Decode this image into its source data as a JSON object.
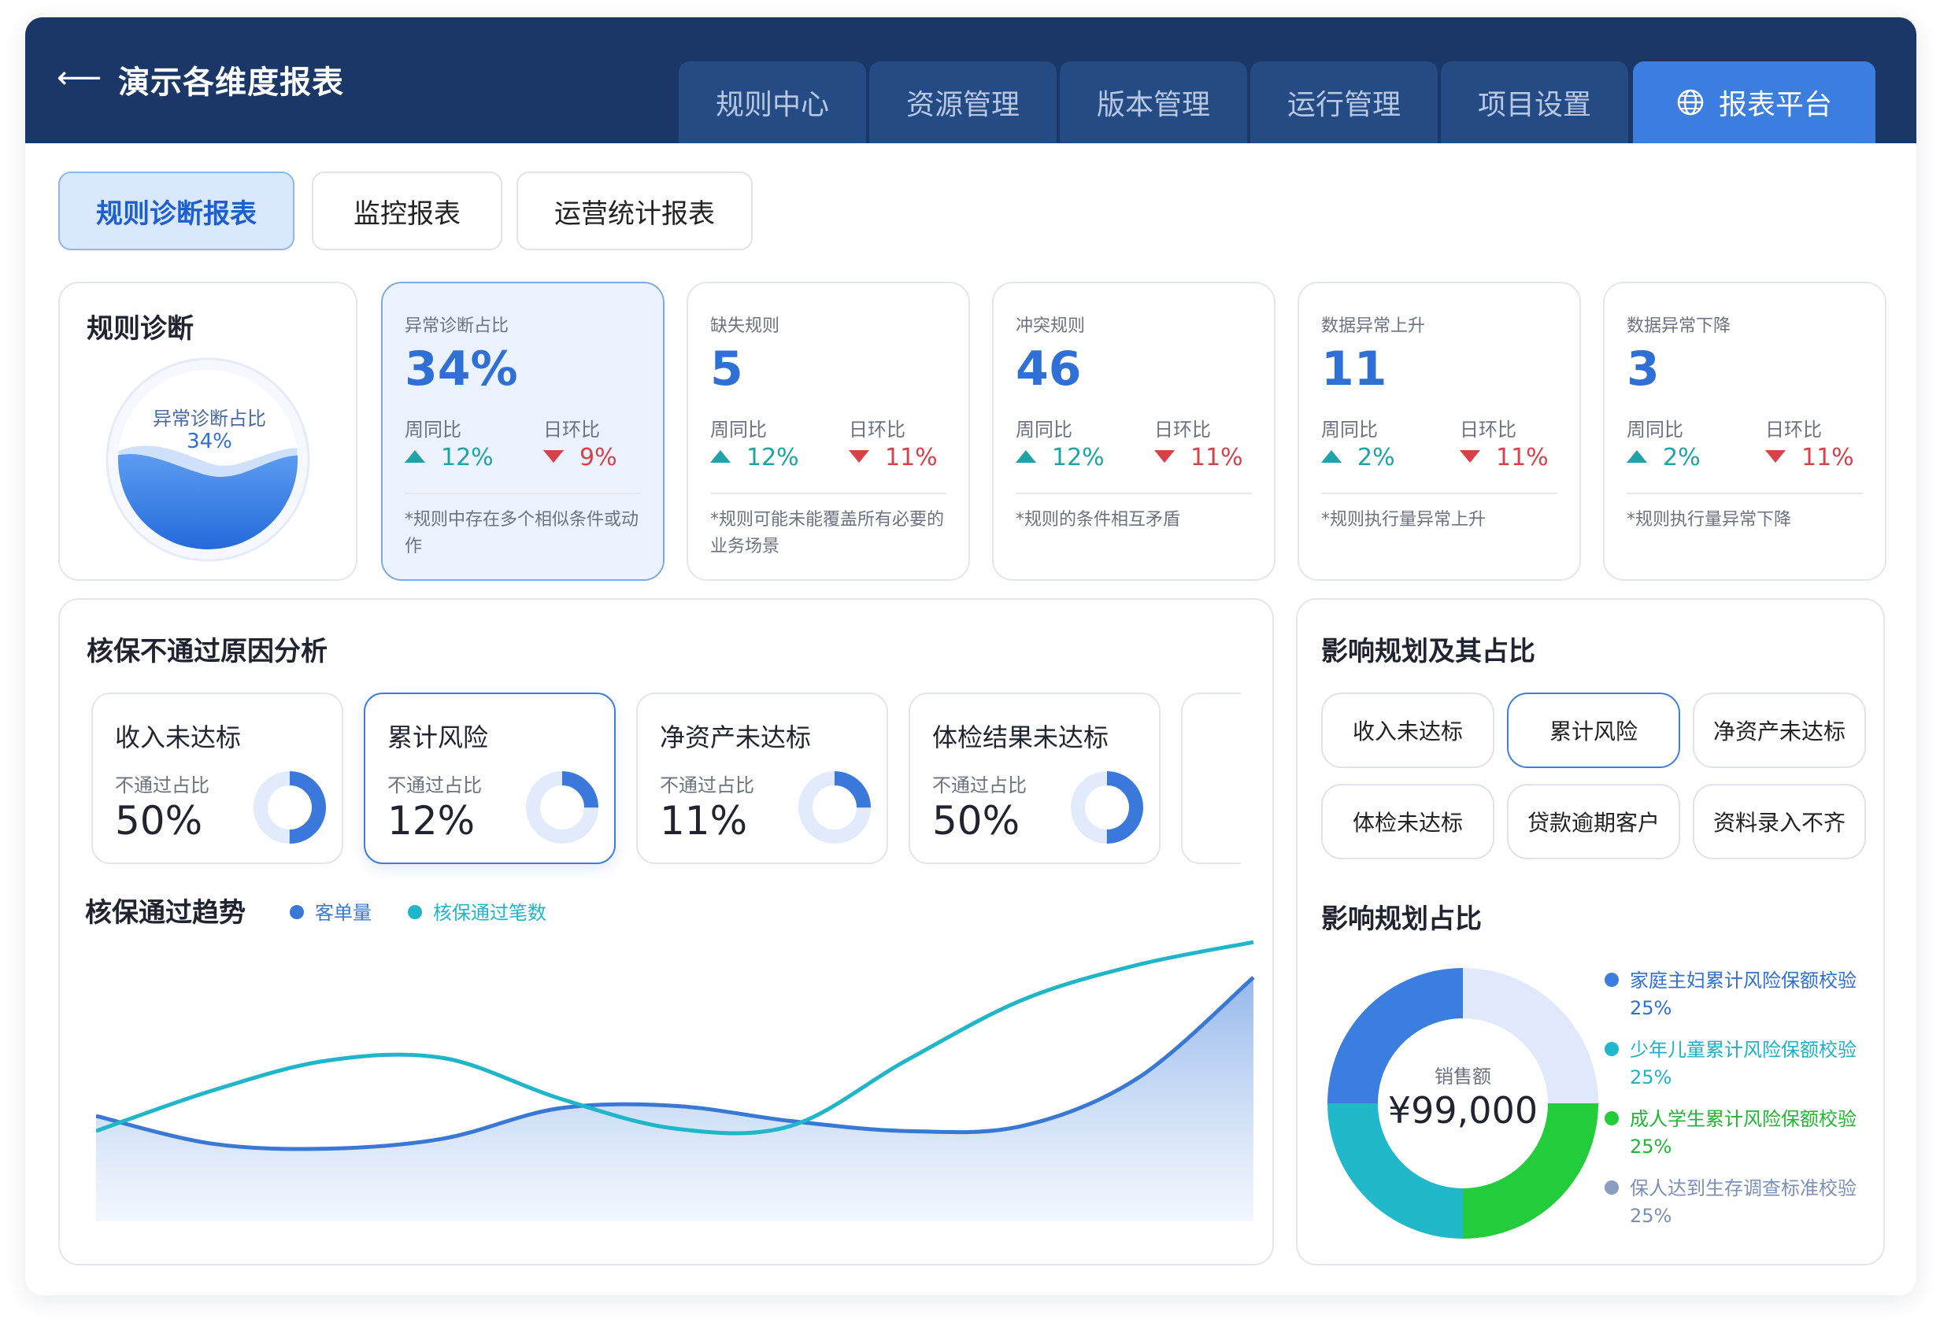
{
  "header": {
    "back_icon": "arrow-left-icon",
    "title": "演示各维度报表",
    "tabs": [
      {
        "label": "规则中心"
      },
      {
        "label": "资源管理"
      },
      {
        "label": "版本管理"
      },
      {
        "label": "运行管理"
      },
      {
        "label": "项目设置"
      },
      {
        "label": "报表平台",
        "active": true,
        "icon": "globe-icon"
      }
    ]
  },
  "subtabs": [
    {
      "label": "规则诊断报表",
      "active": true
    },
    {
      "label": "监控报表"
    },
    {
      "label": "运营统计报表"
    }
  ],
  "diagnosis": {
    "title": "规则诊断",
    "gauge_label": "异常诊断占比",
    "gauge_value": "34%",
    "gauge_level": 0.34
  },
  "stat_cards": [
    {
      "title": "异常诊断占比",
      "value": "34%",
      "wow_label": "周同比",
      "wow": "12%",
      "dod_label": "日环比",
      "dod": "9%",
      "note": "*规则中存在多个相似条件或动作"
    },
    {
      "title": "缺失规则",
      "value": "5",
      "wow_label": "周同比",
      "wow": "12%",
      "dod_label": "日环比",
      "dod": "11%",
      "note": "*规则可能未能覆盖所有必要的业务场景"
    },
    {
      "title": "冲突规则",
      "value": "46",
      "wow_label": "周同比",
      "wow": "12%",
      "dod_label": "日环比",
      "dod": "11%",
      "note": "*规则的条件相互矛盾"
    },
    {
      "title": "数据异常上升",
      "value": "11",
      "wow_label": "周同比",
      "wow": "2%",
      "dod_label": "日环比",
      "dod": "11%",
      "note": "*规则执行量异常上升"
    },
    {
      "title": "数据异常下降",
      "value": "3",
      "wow_label": "周同比",
      "wow": "2%",
      "dod_label": "日环比",
      "dod": "11%",
      "note": "*规则执行量异常下降"
    }
  ],
  "reasons": {
    "title": "核保不通过原因分析",
    "items": [
      {
        "title": "收入未达标",
        "sub": "不通过占比",
        "value": "50%",
        "ratio": 0.5
      },
      {
        "title": "累计风险",
        "sub": "不通过占比",
        "value": "12%",
        "ratio": 0.25,
        "selected": true
      },
      {
        "title": "净资产未达标",
        "sub": "不通过占比",
        "value": "11%",
        "ratio": 0.25
      },
      {
        "title": "体检结果未达标",
        "sub": "不通过占比",
        "value": "50%",
        "ratio": 0.5
      }
    ]
  },
  "trend": {
    "title": "核保通过趋势",
    "legend": [
      {
        "name": "客单量",
        "color": "#3a78d6"
      },
      {
        "name": "核保通过笔数",
        "color": "#1eb6c8"
      }
    ]
  },
  "chart_data": {
    "type": "area",
    "x": [
      0,
      1,
      2,
      3,
      4,
      5,
      6,
      7,
      8,
      9,
      10
    ],
    "series": [
      {
        "name": "客单量",
        "values": [
          40,
          18,
          14,
          22,
          46,
          48,
          36,
          28,
          32,
          70,
          150
        ]
      },
      {
        "name": "核保通过笔数",
        "values": [
          28,
          60,
          84,
          86,
          54,
          30,
          32,
          84,
          132,
          160,
          178
        ]
      }
    ],
    "ylim": [
      0,
      200
    ],
    "grid": false,
    "legend_position": "top-left"
  },
  "impact": {
    "title": "影响规划及其占比",
    "pills": [
      {
        "label": "收入未达标"
      },
      {
        "label": "累计风险",
        "selected": true
      },
      {
        "label": "净资产未达标"
      },
      {
        "label": "体检未达标"
      },
      {
        "label": "贷款逾期客户"
      },
      {
        "label": "资料录入不齐"
      }
    ],
    "share_title": "影响规划占比",
    "center_label": "销售额",
    "center_value": "¥99,000",
    "legend": [
      {
        "name": "家庭主妇累计风险保额校验",
        "pct": "25%",
        "color": "#3c7ee0"
      },
      {
        "name": "少年儿童累计风险保额校验",
        "pct": "25%",
        "color": "#22b8cc"
      },
      {
        "name": "成人学生累计风险保额校验",
        "pct": "25%",
        "color": "#22cc3a"
      },
      {
        "name": "保人达到生存调查标准校验",
        "pct": "25%",
        "color": "#8a9cc0"
      }
    ]
  },
  "donut_data": {
    "type": "pie",
    "categories": [
      "家庭主妇累计风险保额校验",
      "少年儿童累计风险保额校验",
      "成人学生累计风险保额校验",
      "保人达到生存调查标准校验"
    ],
    "values": [
      25,
      25,
      25,
      25
    ],
    "colors": [
      "#3c7ee0",
      "#22b8cc",
      "#22cc3a",
      "#dfe9fb"
    ]
  }
}
